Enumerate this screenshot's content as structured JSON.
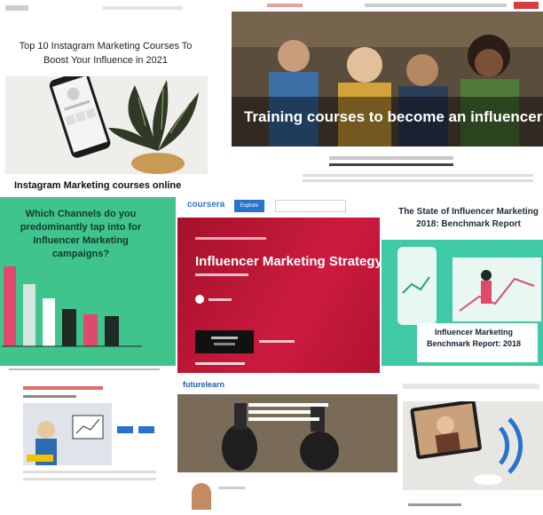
{
  "tile1": {
    "title": "Top 10 Instagram Marketing Courses To Boost Your Influence in 2021",
    "caption": "Instagram Marketing courses online"
  },
  "tile2": {
    "headline": "Training courses to become an influencer: a boom"
  },
  "tile3": {
    "question": "Which Channels do you predominantly tap into for Influencer Marketing campaigns?"
  },
  "tile4": {
    "logo": "coursera",
    "explore": "Explore",
    "ctitle": "Influencer Marketing Strategy"
  },
  "tile5": {
    "title": "The State of Influencer Marketing 2018: Benchmark Report",
    "label": "Influencer Marketing Benchmark Report: 2018"
  },
  "tile7": {
    "logo": "futurelearn"
  },
  "colors": {
    "coursera_red": "#c4163a",
    "green": "#3fc48d",
    "teal": "#3fc9a6",
    "coursera_blue": "#2a73cc"
  }
}
